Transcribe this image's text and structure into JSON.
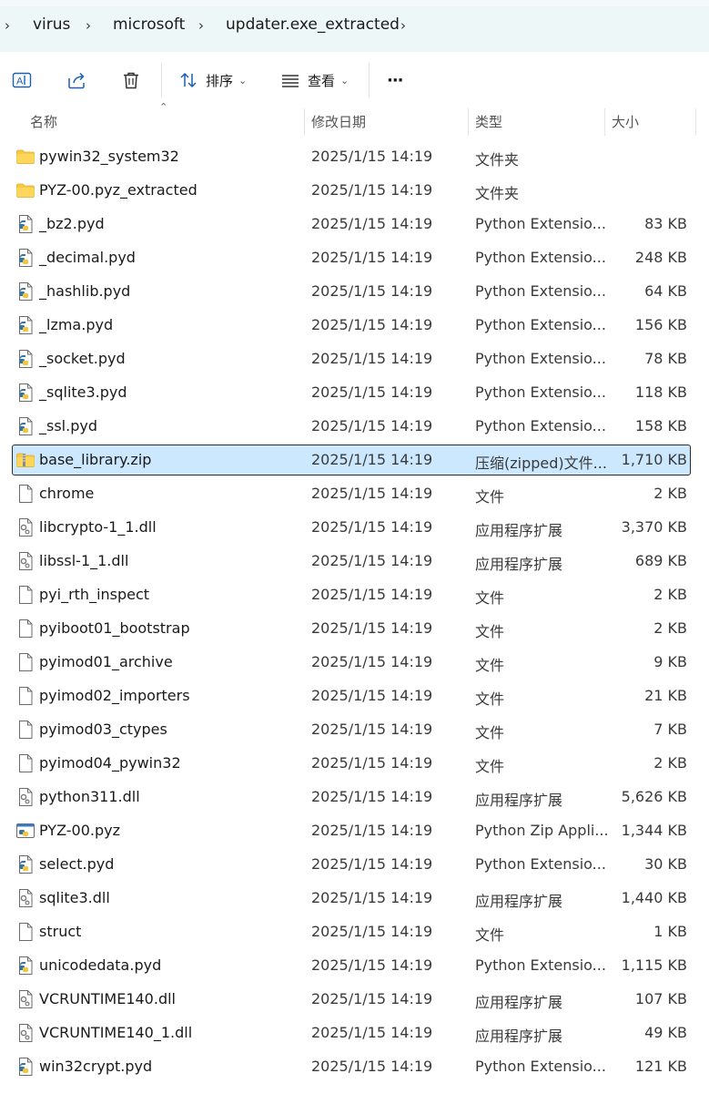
{
  "breadcrumb": {
    "items": [
      "virus",
      "microsoft",
      "updater.exe_extracted"
    ]
  },
  "toolbar": {
    "sort_label": "排序",
    "view_label": "查看",
    "more_label": "···"
  },
  "columns": {
    "name": "名称",
    "date": "修改日期",
    "type": "类型",
    "size": "大小"
  },
  "selected_index": 9,
  "files": [
    {
      "name": "pywin32_system32",
      "date": "2025/1/15 14:19",
      "type": "文件夹",
      "size": "",
      "icon": "folder-icon"
    },
    {
      "name": "PYZ-00.pyz_extracted",
      "date": "2025/1/15 14:19",
      "type": "文件夹",
      "size": "",
      "icon": "folder-icon"
    },
    {
      "name": "_bz2.pyd",
      "date": "2025/1/15 14:19",
      "type": "Python Extensio...",
      "size": "83 KB",
      "icon": "python-file-icon"
    },
    {
      "name": "_decimal.pyd",
      "date": "2025/1/15 14:19",
      "type": "Python Extensio...",
      "size": "248 KB",
      "icon": "python-file-icon"
    },
    {
      "name": "_hashlib.pyd",
      "date": "2025/1/15 14:19",
      "type": "Python Extensio...",
      "size": "64 KB",
      "icon": "python-file-icon"
    },
    {
      "name": "_lzma.pyd",
      "date": "2025/1/15 14:19",
      "type": "Python Extensio...",
      "size": "156 KB",
      "icon": "python-file-icon"
    },
    {
      "name": "_socket.pyd",
      "date": "2025/1/15 14:19",
      "type": "Python Extensio...",
      "size": "78 KB",
      "icon": "python-file-icon"
    },
    {
      "name": "_sqlite3.pyd",
      "date": "2025/1/15 14:19",
      "type": "Python Extensio...",
      "size": "118 KB",
      "icon": "python-file-icon"
    },
    {
      "name": "_ssl.pyd",
      "date": "2025/1/15 14:19",
      "type": "Python Extensio...",
      "size": "158 KB",
      "icon": "python-file-icon"
    },
    {
      "name": "base_library.zip",
      "date": "2025/1/15 14:19",
      "type": "压缩(zipped)文件...",
      "size": "1,710 KB",
      "icon": "zip-folder-icon"
    },
    {
      "name": "chrome",
      "date": "2025/1/15 14:19",
      "type": "文件",
      "size": "2 KB",
      "icon": "blank-file-icon"
    },
    {
      "name": "libcrypto-1_1.dll",
      "date": "2025/1/15 14:19",
      "type": "应用程序扩展",
      "size": "3,370 KB",
      "icon": "dll-file-icon"
    },
    {
      "name": "libssl-1_1.dll",
      "date": "2025/1/15 14:19",
      "type": "应用程序扩展",
      "size": "689 KB",
      "icon": "dll-file-icon"
    },
    {
      "name": "pyi_rth_inspect",
      "date": "2025/1/15 14:19",
      "type": "文件",
      "size": "2 KB",
      "icon": "blank-file-icon"
    },
    {
      "name": "pyiboot01_bootstrap",
      "date": "2025/1/15 14:19",
      "type": "文件",
      "size": "2 KB",
      "icon": "blank-file-icon"
    },
    {
      "name": "pyimod01_archive",
      "date": "2025/1/15 14:19",
      "type": "文件",
      "size": "9 KB",
      "icon": "blank-file-icon"
    },
    {
      "name": "pyimod02_importers",
      "date": "2025/1/15 14:19",
      "type": "文件",
      "size": "21 KB",
      "icon": "blank-file-icon"
    },
    {
      "name": "pyimod03_ctypes",
      "date": "2025/1/15 14:19",
      "type": "文件",
      "size": "7 KB",
      "icon": "blank-file-icon"
    },
    {
      "name": "pyimod04_pywin32",
      "date": "2025/1/15 14:19",
      "type": "文件",
      "size": "2 KB",
      "icon": "blank-file-icon"
    },
    {
      "name": "python311.dll",
      "date": "2025/1/15 14:19",
      "type": "应用程序扩展",
      "size": "5,626 KB",
      "icon": "dll-file-icon"
    },
    {
      "name": "PYZ-00.pyz",
      "date": "2025/1/15 14:19",
      "type": "Python Zip Appli...",
      "size": "1,344 KB",
      "icon": "python-zip-icon"
    },
    {
      "name": "select.pyd",
      "date": "2025/1/15 14:19",
      "type": "Python Extensio...",
      "size": "30 KB",
      "icon": "python-file-icon"
    },
    {
      "name": "sqlite3.dll",
      "date": "2025/1/15 14:19",
      "type": "应用程序扩展",
      "size": "1,440 KB",
      "icon": "dll-file-icon"
    },
    {
      "name": "struct",
      "date": "2025/1/15 14:19",
      "type": "文件",
      "size": "1 KB",
      "icon": "blank-file-icon"
    },
    {
      "name": "unicodedata.pyd",
      "date": "2025/1/15 14:19",
      "type": "Python Extensio...",
      "size": "1,115 KB",
      "icon": "python-file-icon"
    },
    {
      "name": "VCRUNTIME140.dll",
      "date": "2025/1/15 14:19",
      "type": "应用程序扩展",
      "size": "107 KB",
      "icon": "dll-file-icon"
    },
    {
      "name": "VCRUNTIME140_1.dll",
      "date": "2025/1/15 14:19",
      "type": "应用程序扩展",
      "size": "49 KB",
      "icon": "dll-file-icon"
    },
    {
      "name": "win32crypt.pyd",
      "date": "2025/1/15 14:19",
      "type": "Python Extensio...",
      "size": "121 KB",
      "icon": "python-file-icon"
    }
  ]
}
